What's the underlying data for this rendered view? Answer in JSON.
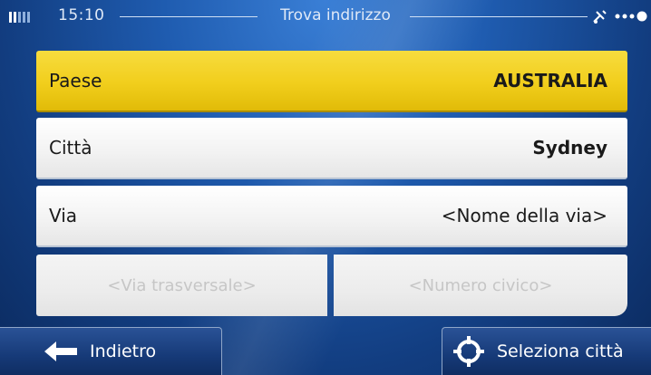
{
  "status_bar": {
    "time": "15:10",
    "title": "Trova indirizzo",
    "icons": [
      "signal-icon",
      "gps-icon",
      "dots-icon"
    ]
  },
  "form": {
    "country": {
      "label": "Paese",
      "value": "AUSTRALIA"
    },
    "city": {
      "label": "Città",
      "value": "Sydney"
    },
    "street": {
      "label": "Via",
      "value": "<Nome della via>"
    },
    "cross_street_placeholder": "<Via trasversale>",
    "house_number_placeholder": "<Numero civico>"
  },
  "bottom_bar": {
    "back_label": "Indietro",
    "select_city_label": "Seleziona città",
    "icons": [
      "back-arrow-icon",
      "crosshair-icon"
    ]
  },
  "colors": {
    "highlight": "#f1ce1c",
    "background": "#1f5cb0",
    "disabled_text": "#c6c6c6"
  }
}
